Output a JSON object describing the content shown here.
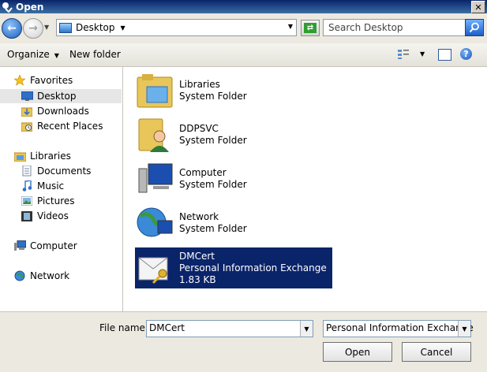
{
  "window": {
    "title": "Open",
    "close_glyph": "✕"
  },
  "address": {
    "location": "Desktop",
    "search_placeholder": "Search Desktop"
  },
  "toolbar": {
    "organize": "Organize",
    "new_folder": "New folder"
  },
  "navpane": {
    "favorites": "Favorites",
    "favorites_items": [
      "Desktop",
      "Downloads",
      "Recent Places"
    ],
    "libraries": "Libraries",
    "libraries_items": [
      "Documents",
      "Music",
      "Pictures",
      "Videos"
    ],
    "computer": "Computer",
    "network": "Network"
  },
  "files": [
    {
      "name": "Libraries",
      "type": "System Folder",
      "icon": "libraries-folder-icon"
    },
    {
      "name": "DDPSVC",
      "type": "System Folder",
      "icon": "user-folder-icon"
    },
    {
      "name": "Computer",
      "type": "System Folder",
      "icon": "computer-icon"
    },
    {
      "name": "Network",
      "type": "System Folder",
      "icon": "network-globe-icon"
    },
    {
      "name": "DMCert",
      "type": "Personal Information Exchange",
      "size": "1.83 KB",
      "icon": "certificate-key-icon",
      "selected": true
    }
  ],
  "footer": {
    "file_name_label": "File name:",
    "file_name_value": "DMCert",
    "file_type_value": "Personal Information Exchange",
    "open": "Open",
    "cancel": "Cancel"
  },
  "colors": {
    "selection": "#0a246a",
    "titlebar": "#0a246a"
  }
}
